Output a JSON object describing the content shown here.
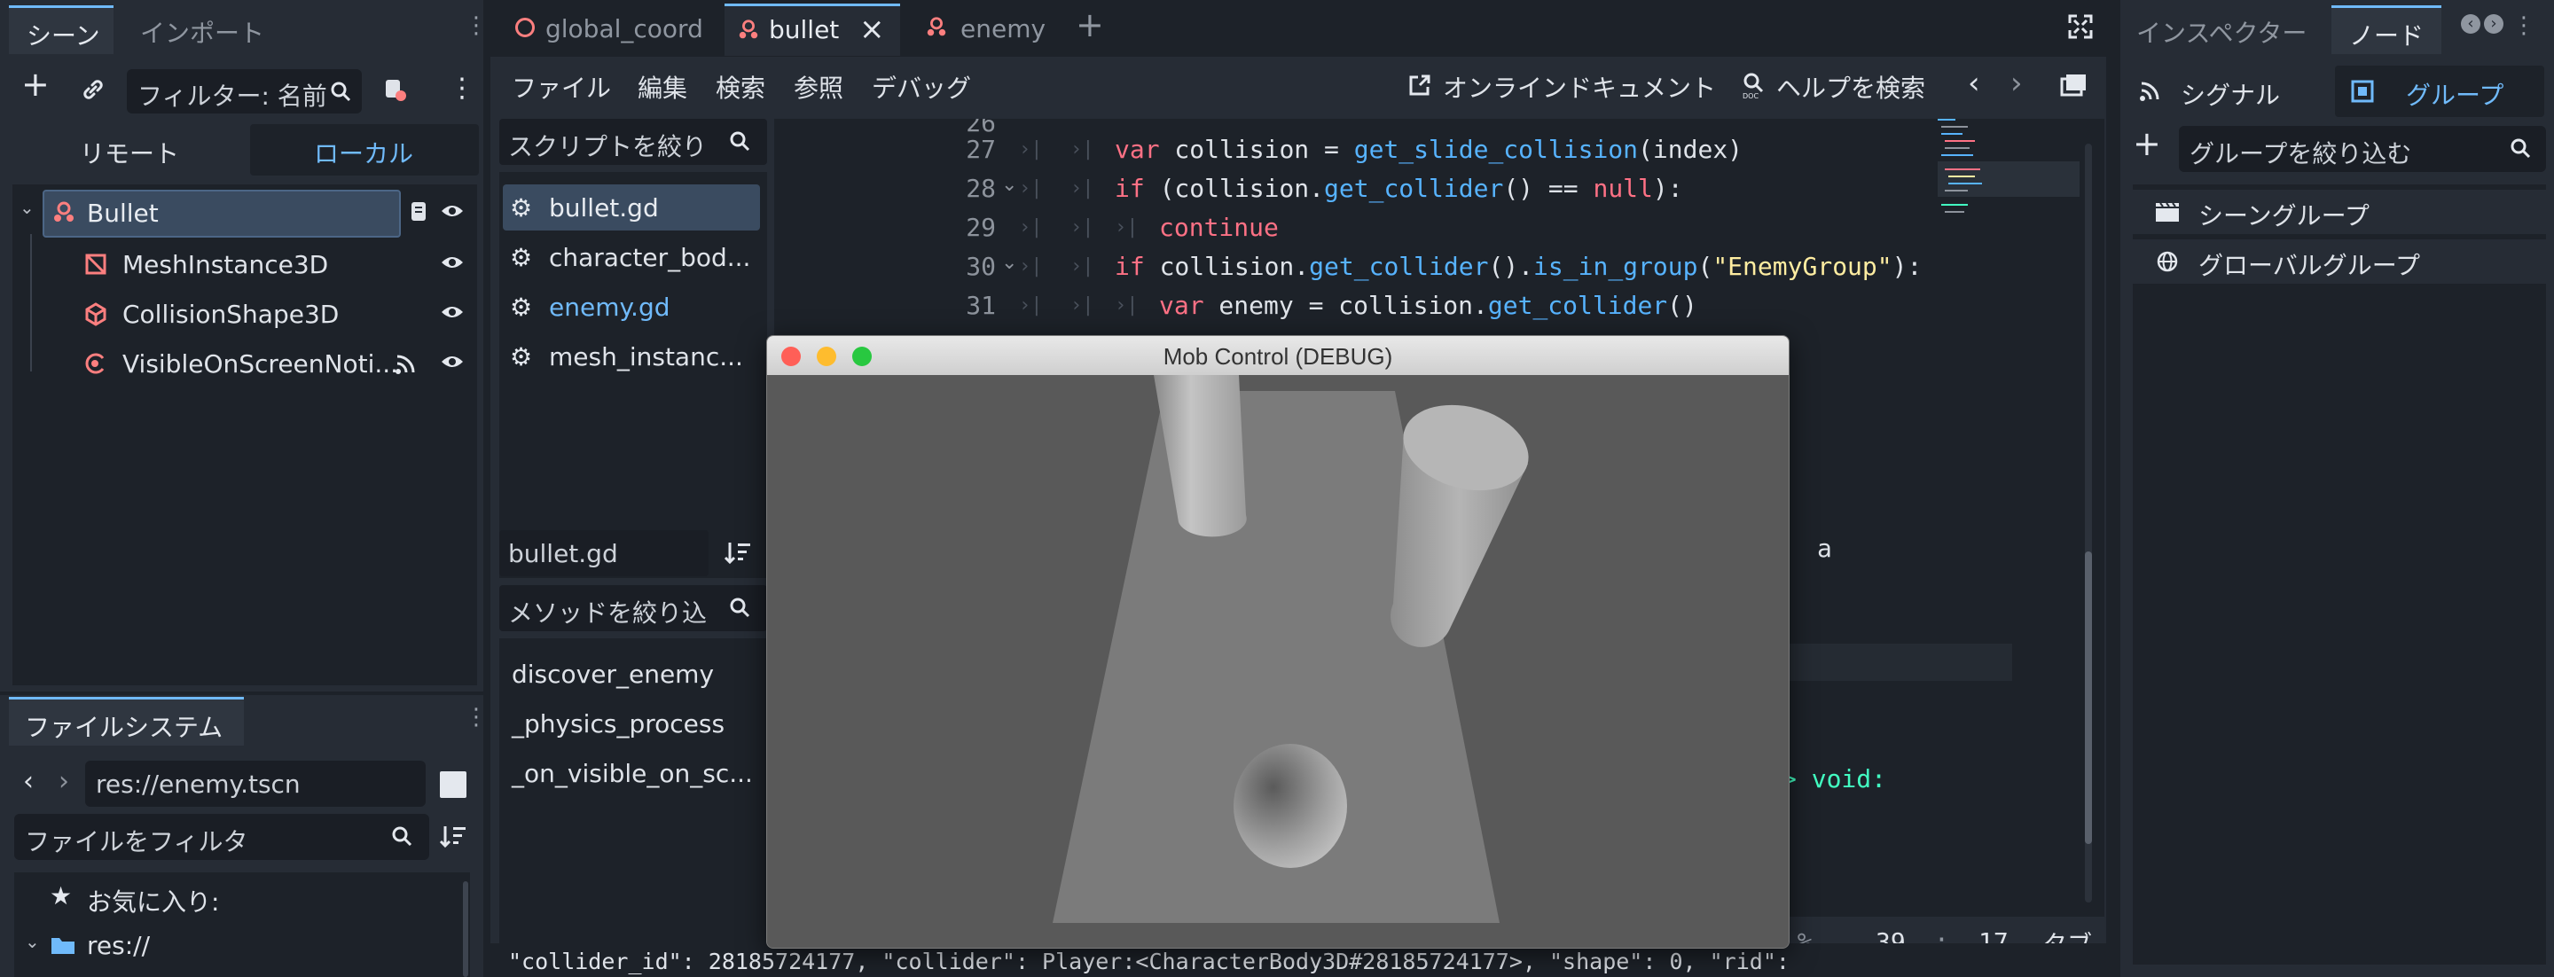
{
  "scene_dock": {
    "tabs": [
      "シーン",
      "インポート"
    ],
    "filter_placeholder": "フィルター: 名前",
    "toggle": [
      "リモート",
      "ローカル"
    ],
    "tree": [
      {
        "label": "Bullet",
        "icon": "node3d-icon"
      },
      {
        "label": "MeshInstance3D",
        "icon": "mesh-icon"
      },
      {
        "label": "CollisionShape3D",
        "icon": "collision-shape-icon"
      },
      {
        "label": "VisibleOnScreenNoti...",
        "icon": "visible-notifier-icon"
      }
    ]
  },
  "filesystem": {
    "title": "ファイルシステム",
    "path": "res://enemy.tscn",
    "filter_placeholder": "ファイルをフィルタ",
    "favorites": "お気に入り:",
    "root": "res://"
  },
  "editor_tabs": [
    {
      "label": "global_coord"
    },
    {
      "label": "bullet"
    },
    {
      "label": "enemy"
    }
  ],
  "menu": [
    "ファイル",
    "編集",
    "検索",
    "参照",
    "デバッグ"
  ],
  "toolbar": {
    "online_docs": "オンラインドキュメント",
    "search_help": "ヘルプを検索"
  },
  "scripts": {
    "filter_placeholder": "スクリプトを絞り",
    "items": [
      "bullet.gd",
      "character_bod...",
      "enemy.gd",
      "mesh_instanc..."
    ],
    "current": "bullet.gd",
    "method_filter_placeholder": "メソッドを絞り込",
    "methods": [
      "discover_enemy",
      "_physics_process",
      "_on_visible_on_sc..."
    ]
  },
  "code": {
    "partial_top": "26",
    "lines": [
      {
        "n": "27",
        "indent": 0
      },
      {
        "n": "28",
        "indent": 0
      },
      {
        "n": "29",
        "indent": 1
      },
      {
        "n": "30",
        "indent": 0
      },
      {
        "n": "31",
        "indent": 1
      }
    ],
    "fragment_a": "a",
    "fragment_void": "> void:",
    "status": {
      "zoom": "0 %",
      "line": "39",
      "col": "17",
      "indent": "タブ"
    }
  },
  "output_line": "\"collider_id\": 28185724177, \"collider\": Player:<CharacterBody3D#28185724177>, \"shape\": 0, \"rid\":",
  "debug_window": {
    "title": "Mob Control (DEBUG)"
  },
  "right_dock": {
    "tabs": [
      "インスペクター",
      "ノード"
    ],
    "subtabs": [
      "シグナル",
      "グループ"
    ],
    "filter_placeholder": "グループを絞り込む",
    "groups": [
      "シーングループ",
      "グローバルグループ"
    ]
  },
  "colors": {
    "accent": "#70bafa",
    "scene_icon": "#fc7f7f",
    "background": "#1d2229",
    "panel": "#262c35"
  }
}
